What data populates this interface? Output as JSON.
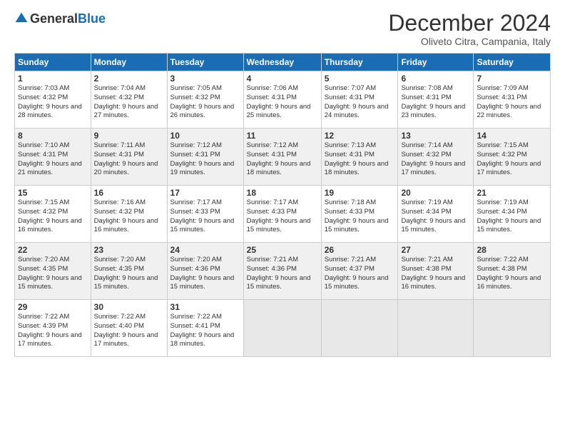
{
  "logo": {
    "general": "General",
    "blue": "Blue"
  },
  "title": "December 2024",
  "location": "Oliveto Citra, Campania, Italy",
  "days_of_week": [
    "Sunday",
    "Monday",
    "Tuesday",
    "Wednesday",
    "Thursday",
    "Friday",
    "Saturday"
  ],
  "weeks": [
    [
      {
        "day": "1",
        "sunrise": "7:03 AM",
        "sunset": "4:32 PM",
        "daylight": "9 hours and 28 minutes."
      },
      {
        "day": "2",
        "sunrise": "7:04 AM",
        "sunset": "4:32 PM",
        "daylight": "9 hours and 27 minutes."
      },
      {
        "day": "3",
        "sunrise": "7:05 AM",
        "sunset": "4:32 PM",
        "daylight": "9 hours and 26 minutes."
      },
      {
        "day": "4",
        "sunrise": "7:06 AM",
        "sunset": "4:31 PM",
        "daylight": "9 hours and 25 minutes."
      },
      {
        "day": "5",
        "sunrise": "7:07 AM",
        "sunset": "4:31 PM",
        "daylight": "9 hours and 24 minutes."
      },
      {
        "day": "6",
        "sunrise": "7:08 AM",
        "sunset": "4:31 PM",
        "daylight": "9 hours and 23 minutes."
      },
      {
        "day": "7",
        "sunrise": "7:09 AM",
        "sunset": "4:31 PM",
        "daylight": "9 hours and 22 minutes."
      }
    ],
    [
      {
        "day": "8",
        "sunrise": "7:10 AM",
        "sunset": "4:31 PM",
        "daylight": "9 hours and 21 minutes."
      },
      {
        "day": "9",
        "sunrise": "7:11 AM",
        "sunset": "4:31 PM",
        "daylight": "9 hours and 20 minutes."
      },
      {
        "day": "10",
        "sunrise": "7:12 AM",
        "sunset": "4:31 PM",
        "daylight": "9 hours and 19 minutes."
      },
      {
        "day": "11",
        "sunrise": "7:12 AM",
        "sunset": "4:31 PM",
        "daylight": "9 hours and 18 minutes."
      },
      {
        "day": "12",
        "sunrise": "7:13 AM",
        "sunset": "4:31 PM",
        "daylight": "9 hours and 18 minutes."
      },
      {
        "day": "13",
        "sunrise": "7:14 AM",
        "sunset": "4:32 PM",
        "daylight": "9 hours and 17 minutes."
      },
      {
        "day": "14",
        "sunrise": "7:15 AM",
        "sunset": "4:32 PM",
        "daylight": "9 hours and 17 minutes."
      }
    ],
    [
      {
        "day": "15",
        "sunrise": "7:15 AM",
        "sunset": "4:32 PM",
        "daylight": "9 hours and 16 minutes."
      },
      {
        "day": "16",
        "sunrise": "7:16 AM",
        "sunset": "4:32 PM",
        "daylight": "9 hours and 16 minutes."
      },
      {
        "day": "17",
        "sunrise": "7:17 AM",
        "sunset": "4:33 PM",
        "daylight": "9 hours and 15 minutes."
      },
      {
        "day": "18",
        "sunrise": "7:17 AM",
        "sunset": "4:33 PM",
        "daylight": "9 hours and 15 minutes."
      },
      {
        "day": "19",
        "sunrise": "7:18 AM",
        "sunset": "4:33 PM",
        "daylight": "9 hours and 15 minutes."
      },
      {
        "day": "20",
        "sunrise": "7:19 AM",
        "sunset": "4:34 PM",
        "daylight": "9 hours and 15 minutes."
      },
      {
        "day": "21",
        "sunrise": "7:19 AM",
        "sunset": "4:34 PM",
        "daylight": "9 hours and 15 minutes."
      }
    ],
    [
      {
        "day": "22",
        "sunrise": "7:20 AM",
        "sunset": "4:35 PM",
        "daylight": "9 hours and 15 minutes."
      },
      {
        "day": "23",
        "sunrise": "7:20 AM",
        "sunset": "4:35 PM",
        "daylight": "9 hours and 15 minutes."
      },
      {
        "day": "24",
        "sunrise": "7:20 AM",
        "sunset": "4:36 PM",
        "daylight": "9 hours and 15 minutes."
      },
      {
        "day": "25",
        "sunrise": "7:21 AM",
        "sunset": "4:36 PM",
        "daylight": "9 hours and 15 minutes."
      },
      {
        "day": "26",
        "sunrise": "7:21 AM",
        "sunset": "4:37 PM",
        "daylight": "9 hours and 15 minutes."
      },
      {
        "day": "27",
        "sunrise": "7:21 AM",
        "sunset": "4:38 PM",
        "daylight": "9 hours and 16 minutes."
      },
      {
        "day": "28",
        "sunrise": "7:22 AM",
        "sunset": "4:38 PM",
        "daylight": "9 hours and 16 minutes."
      }
    ],
    [
      {
        "day": "29",
        "sunrise": "7:22 AM",
        "sunset": "4:39 PM",
        "daylight": "9 hours and 17 minutes."
      },
      {
        "day": "30",
        "sunrise": "7:22 AM",
        "sunset": "4:40 PM",
        "daylight": "9 hours and 17 minutes."
      },
      {
        "day": "31",
        "sunrise": "7:22 AM",
        "sunset": "4:41 PM",
        "daylight": "9 hours and 18 minutes."
      },
      null,
      null,
      null,
      null
    ]
  ],
  "labels": {
    "sunrise": "Sunrise: ",
    "sunset": "Sunset: ",
    "daylight": "Daylight: "
  }
}
